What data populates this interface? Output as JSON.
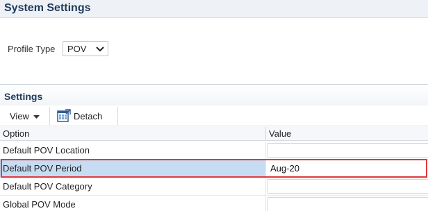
{
  "header": {
    "title": "System Settings"
  },
  "profile": {
    "label": "Profile Type",
    "selected": "POV"
  },
  "settings": {
    "title": "Settings",
    "toolbar": {
      "view_label": "View",
      "detach_label": "Detach"
    },
    "columns": {
      "option": "Option",
      "value": "Value"
    },
    "rows": [
      {
        "option": "Default POV Location",
        "value": ""
      },
      {
        "option": "Default POV Period",
        "value": "Aug-20",
        "selected": true,
        "highlighted": true
      },
      {
        "option": "Default POV Category",
        "value": ""
      },
      {
        "option": "Global POV Mode",
        "value": ""
      }
    ]
  },
  "colors": {
    "title_text": "#1f3b5a",
    "selected_row": "#c6dcf3",
    "highlight": "#e03a3a"
  }
}
